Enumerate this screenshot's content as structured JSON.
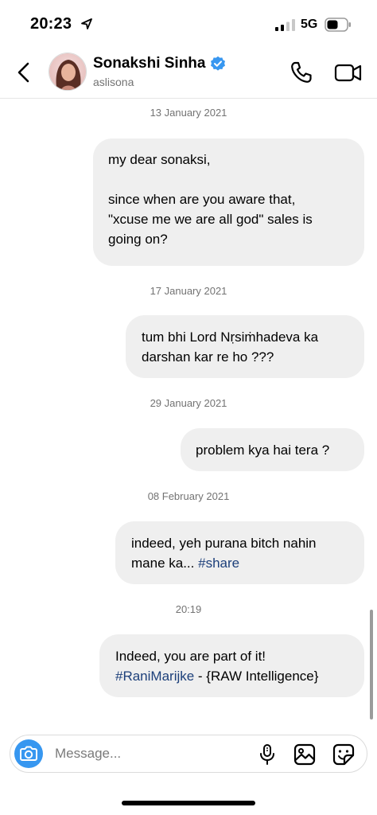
{
  "status_bar": {
    "time": "20:23",
    "network": "5G",
    "location_icon": "location-arrow-icon",
    "signal_icon": "signal-bars-icon",
    "battery_icon": "battery-icon"
  },
  "header": {
    "contact_name": "Sonakshi Sinha",
    "handle": "aslisona",
    "verified_icon": "verified-badge-icon",
    "back_icon": "chevron-left-icon",
    "call_icon": "phone-icon",
    "video_icon": "video-camera-icon"
  },
  "conversation": [
    {
      "date": "13 January 2021",
      "lines": [
        [
          "my dear sonaksi,"
        ],
        [
          ""
        ],
        [
          "since when are you aware that,"
        ],
        [
          "\"xcuse me we are all god\" sales is"
        ],
        [
          "going on?"
        ]
      ]
    },
    {
      "date": "17 January 2021",
      "lines": [
        [
          "tum bhi Lord Nṛsiṁhadeva ka"
        ],
        [
          "darshan kar re ho ???"
        ]
      ]
    },
    {
      "date": "29 January 2021",
      "lines": [
        [
          "problem kya hai tera ?"
        ]
      ]
    },
    {
      "date": "08 February 2021",
      "lines": [
        [
          "indeed, yeh purana bitch nahin"
        ],
        [
          "mane ka... ",
          "#share"
        ]
      ]
    },
    {
      "date": "20:19",
      "lines": [
        [
          "Indeed, you are part of it!"
        ],
        [
          "#RaniMarijke",
          " - {RAW Intelligence}"
        ]
      ]
    }
  ],
  "composer": {
    "placeholder": "Message...",
    "camera_icon": "camera-icon",
    "mic_icon": "microphone-icon",
    "gallery_icon": "gallery-image-icon",
    "sticker_icon": "sticker-icon"
  },
  "colors": {
    "bubble_background": "#efefef",
    "hashtag": "#1c3f7a",
    "camera_button": "#3797f0",
    "verified": "#3897f0",
    "timestamp_text": "#737373"
  }
}
